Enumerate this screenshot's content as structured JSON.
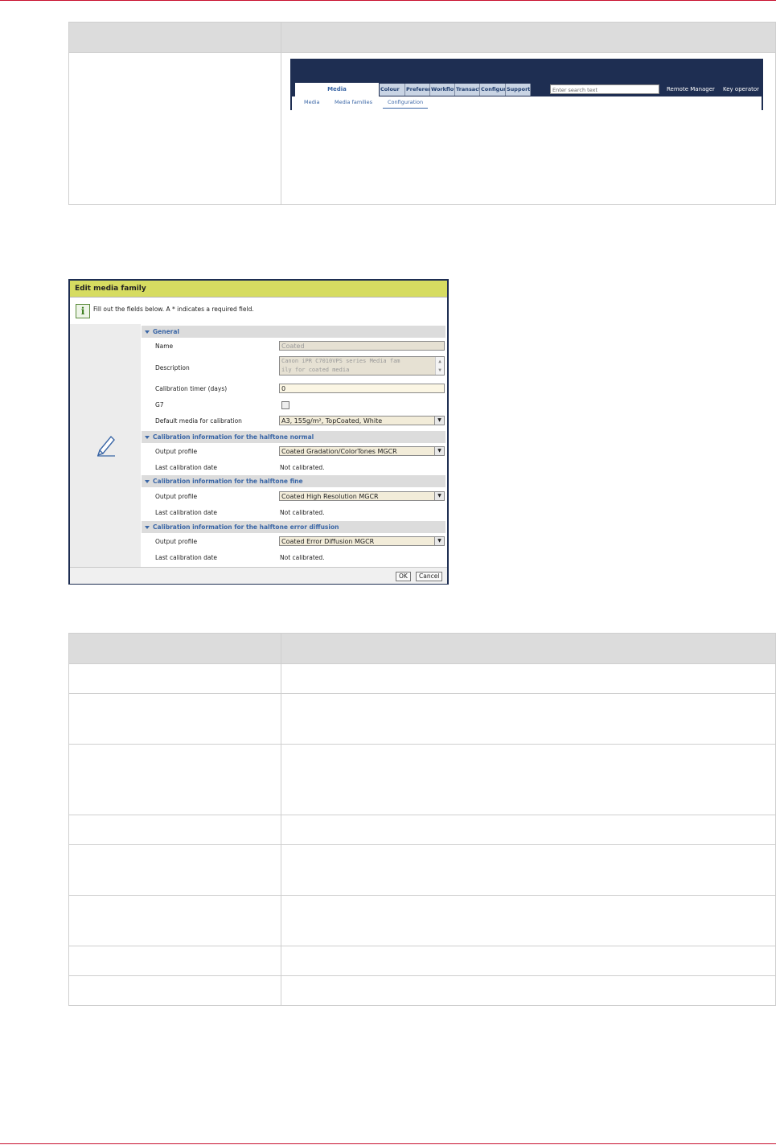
{
  "menubar": {
    "main_tab": "Media",
    "tabs": [
      "Colour",
      "Preferences",
      "Workflow",
      "Transactions",
      "Configuration",
      "Support"
    ],
    "search_placeholder": "Enter search text",
    "remote_manager": "Remote Manager",
    "key_operator": "Key operator",
    "subtabs": [
      "Media",
      "Media families",
      "Configuration"
    ],
    "active_subtab": "Configuration"
  },
  "dialog": {
    "title": "Edit media family",
    "info_text": "Fill out the fields below. A * indicates a required field.",
    "ok_label": "OK",
    "cancel_label": "Cancel",
    "general": {
      "heading": "General",
      "name_label": "Name",
      "name_value": "Coated",
      "description_label": "Description",
      "description_line1": "Canon iPR C7010VPS series Media fam",
      "description_line2": "ily for coated media",
      "timer_label": "Calibration timer (days)",
      "timer_value": "0",
      "g7_label": "G7",
      "default_media_label": "Default media for calibration",
      "default_media_value": "A3, 155g/m², TopCoated, White"
    },
    "halftone_normal": {
      "heading": "Calibration information for the halftone normal",
      "output_profile_label": "Output profile",
      "output_profile_value": "Coated Gradation/ColorTones MGCR",
      "last_date_label": "Last calibration date",
      "last_date_value": "Not calibrated."
    },
    "halftone_fine": {
      "heading": "Calibration information for the halftone fine",
      "output_profile_label": "Output profile",
      "output_profile_value": "Coated High Resolution MGCR",
      "last_date_label": "Last calibration date",
      "last_date_value": "Not calibrated."
    },
    "halftone_error": {
      "heading": "Calibration information for the halftone error diffusion",
      "output_profile_label": "Output profile",
      "output_profile_value": "Coated Error Diffusion MGCR",
      "last_date_label": "Last calibration date",
      "last_date_value": "Not calibrated."
    }
  },
  "colors": {
    "accent_rule": "#c8102e",
    "title_bar": "#d6dc61",
    "menu_navy": "#1e2e52",
    "link_blue": "#3a66a6"
  }
}
